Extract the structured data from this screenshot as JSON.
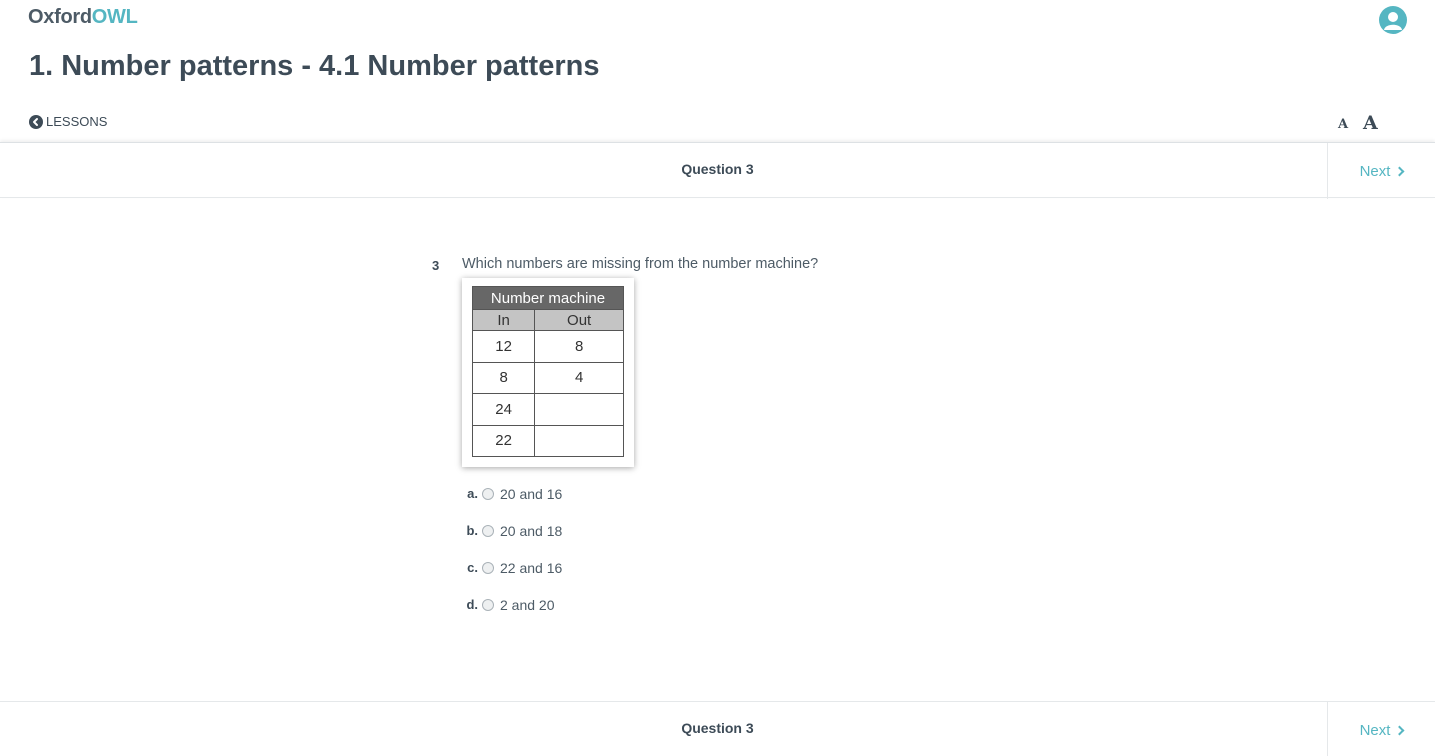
{
  "header": {
    "logo_oxford": "Oxford",
    "logo_owl": "OWL",
    "page_title": "1. Number patterns - 4.1 Number patterns",
    "lessons_label": "LESSONS",
    "font_small_label": "A",
    "font_large_label": "A"
  },
  "question_bar": {
    "label": "Question 3",
    "next_label": "Next"
  },
  "question": {
    "number": "3",
    "text": "Which numbers are missing from the number machine?",
    "machine": {
      "title": "Number machine",
      "col_in": "In",
      "col_out": "Out",
      "rows": [
        {
          "in": "12",
          "out": "8"
        },
        {
          "in": "8",
          "out": "4"
        },
        {
          "in": "24",
          "out": ""
        },
        {
          "in": "22",
          "out": ""
        }
      ]
    },
    "options": [
      {
        "letter": "a.",
        "text": "20 and 16"
      },
      {
        "letter": "b.",
        "text": "20 and 18"
      },
      {
        "letter": "c.",
        "text": "22 and 16"
      },
      {
        "letter": "d.",
        "text": "2 and 20"
      }
    ]
  },
  "colors": {
    "accent": "#55b6c2",
    "text": "#3d4b57"
  },
  "icons": {
    "logo_o": "owl-circle-icon",
    "user": "user-icon",
    "back": "chevron-left-circle-icon",
    "next": "chevron-right-icon"
  }
}
